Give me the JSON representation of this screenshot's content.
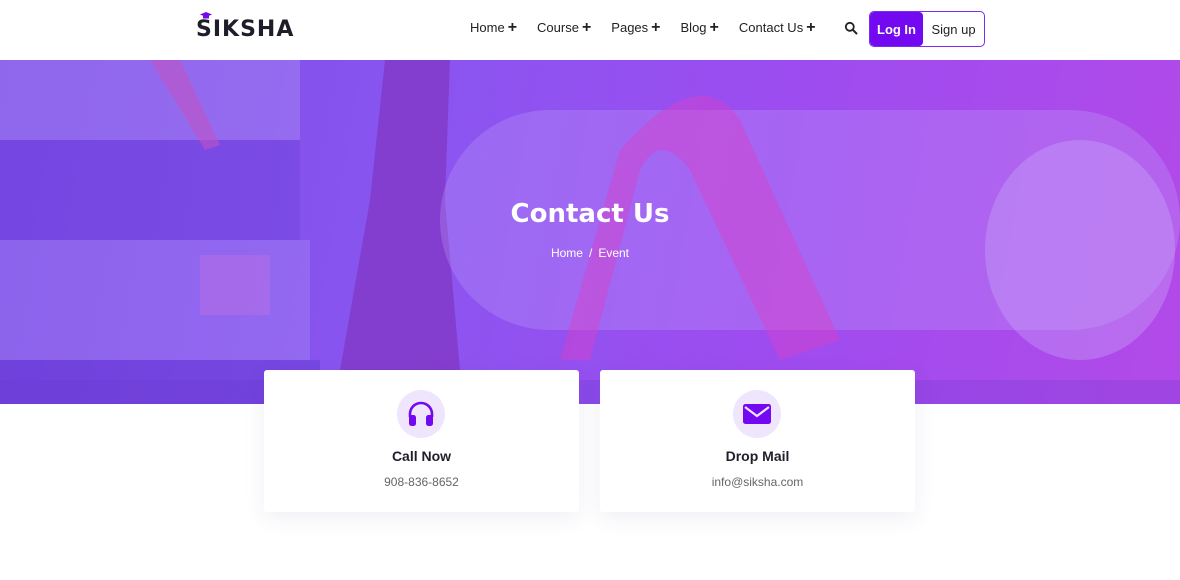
{
  "brand": {
    "name": "SIKSHA",
    "accent": "#7209f0"
  },
  "nav": {
    "items": [
      {
        "label": "Home",
        "suffix": "+"
      },
      {
        "label": "Course",
        "suffix": "+"
      },
      {
        "label": "Pages",
        "suffix": "+"
      },
      {
        "label": "Blog",
        "suffix": "+"
      },
      {
        "label": "Contact Us",
        "suffix": "+"
      }
    ],
    "search_icon": "search-icon"
  },
  "auth": {
    "login_label": "Log In",
    "signup_label": "Sign up"
  },
  "hero": {
    "title": "Contact Us",
    "breadcrumb": {
      "home": "Home",
      "separator": "/",
      "current": "Event"
    }
  },
  "cards": [
    {
      "icon": "headphones-icon",
      "title": "Call Now",
      "text": "908-836-8652"
    },
    {
      "icon": "envelope-icon",
      "title": "Drop Mail",
      "text": "info@siksha.com"
    }
  ]
}
